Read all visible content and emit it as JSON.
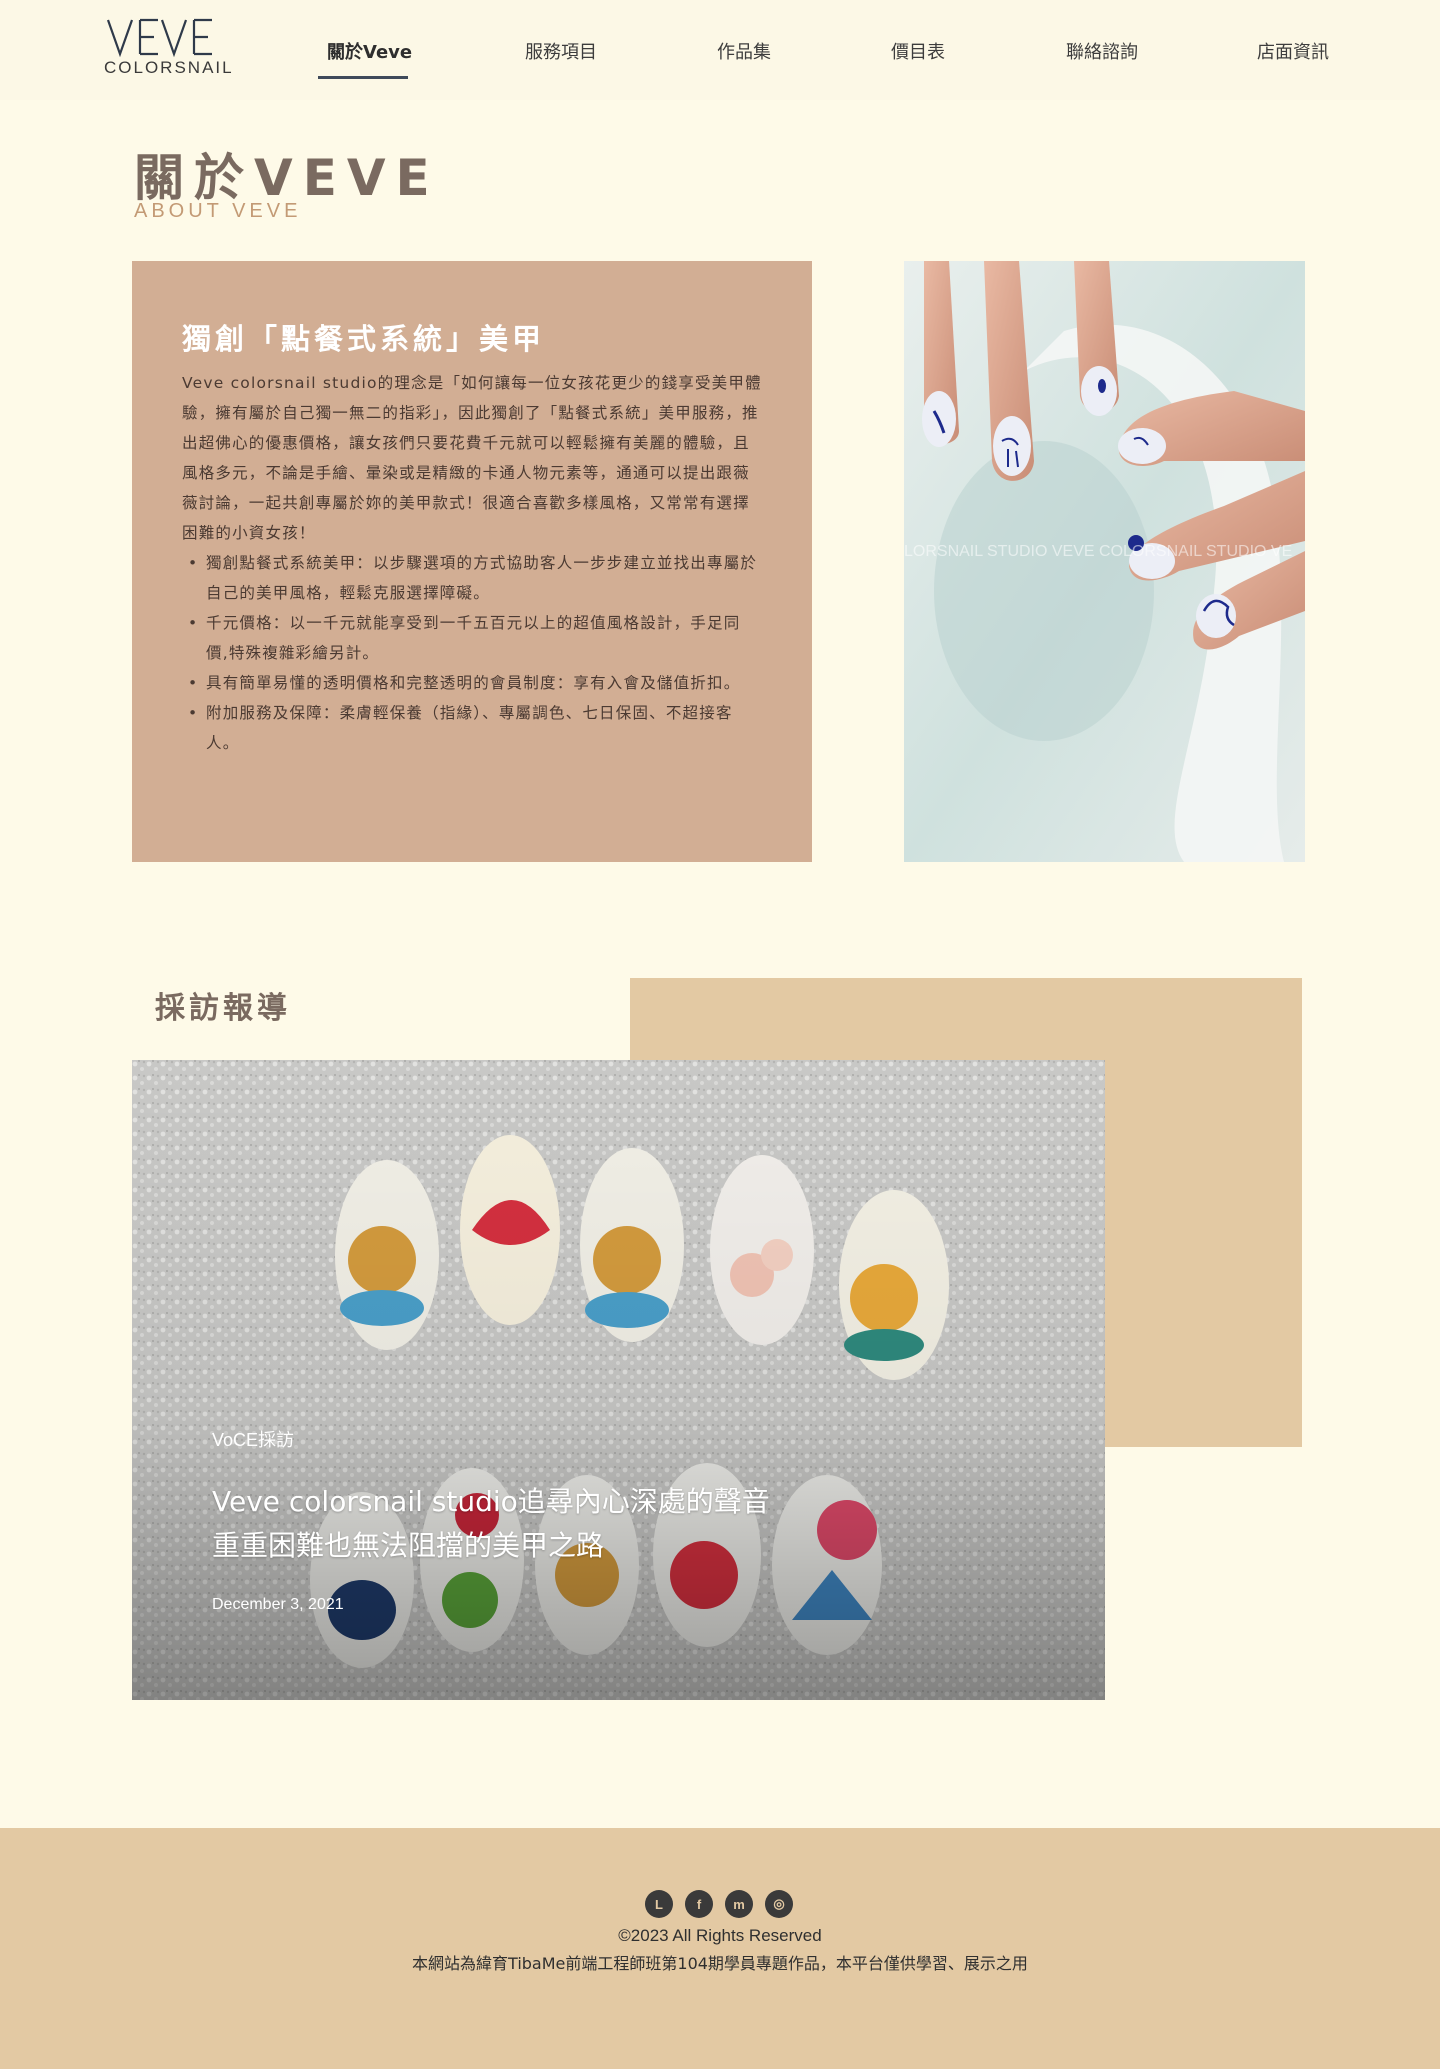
{
  "header": {
    "logo_sub": "COLORSNAIL",
    "logo_alt": "VEVE",
    "nav": [
      {
        "label": "關於Veve",
        "active": true
      },
      {
        "label": "服務項目",
        "active": false
      },
      {
        "label": "作品集",
        "active": false
      },
      {
        "label": "價目表",
        "active": false
      },
      {
        "label": "聯絡諮詢",
        "active": false
      },
      {
        "label": "店面資訊",
        "active": false
      }
    ]
  },
  "about": {
    "title": "關於VEVE",
    "subtitle": "ABOUT VEVE",
    "card": {
      "title": "獨創「點餐式系統」美甲",
      "intro": "Veve colorsnail studio的理念是「如何讓每一位女孩花更少的錢享受美甲體驗，擁有屬於自己獨一無二的指彩」，因此獨創了「點餐式系統」美甲服務，推出超佛心的優惠價格，讓女孩們只要花費千元就可以輕鬆擁有美麗的體驗，且風格多元，不論是手繪、暈染或是精緻的卡通人物元素等，通通可以提出跟薇薇討論，一起共創專屬於妳的美甲款式！很適合喜歡多樣風格，又常常有選擇困難的小資女孩！",
      "bullets": [
        "獨創點餐式系統美甲：以步驟選項的方式協助客人一步步建立並找出專屬於自己的美甲風格，輕鬆克服選擇障礙。",
        "千元價格：以一千元就能享受到一千五百元以上的超值風格設計，手足同價,特殊複雜彩繪另計。",
        "具有簡單易懂的透明價格和完整透明的會員制度：享有入會及儲值折扣。",
        "附加服務及保障：柔膚輕保養（指緣）、專屬調色、七日保固、不超接客人。"
      ]
    },
    "photo_watermark": "LORSNAIL STUDIO  VEVE COLORSNAIL STUDIO  VE"
  },
  "media": {
    "title": "採訪報導",
    "article": {
      "tag": "VoCE採訪",
      "headline_line1": "Veve colorsnail studio追尋內心深處的聲音",
      "headline_line2": "重重困難也無法阻擋的美甲之路",
      "date": "December 3, 2021"
    }
  },
  "footer": {
    "social": [
      {
        "name": "line-icon",
        "glyph": "L"
      },
      {
        "name": "facebook-icon",
        "glyph": "f"
      },
      {
        "name": "messenger-icon",
        "glyph": "m"
      },
      {
        "name": "instagram-icon",
        "glyph": "◎"
      }
    ],
    "copyright": "©2023 All Rights Reserved",
    "disclaimer": "本網站為緯育TibaMe前端工程師班第104期學員專題作品，本平台僅供學習、展示之用"
  },
  "colors": {
    "background": "#fefae8",
    "card": "#d2ae94",
    "accent": "#e3c9a3",
    "title": "#7a6a60",
    "subtitle": "#c39a75"
  }
}
